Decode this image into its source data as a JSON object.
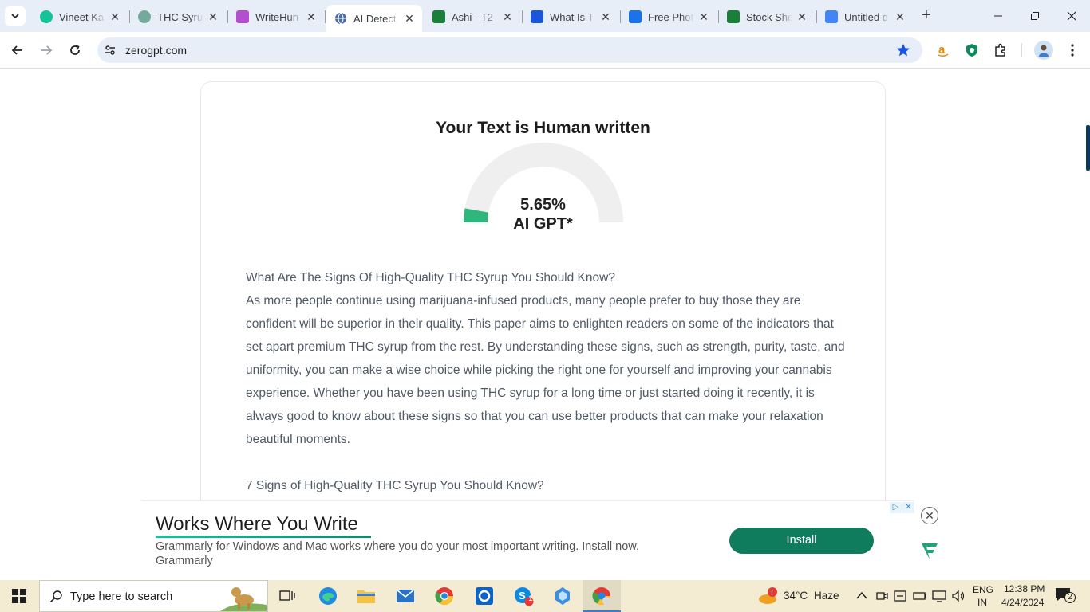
{
  "browser": {
    "tabs": [
      {
        "title": "Vineet Ka",
        "icon": "grammarly-icon",
        "color": "#15c39a",
        "active": false
      },
      {
        "title": "THC Syru",
        "icon": "chatgpt-icon",
        "color": "#74aa9c",
        "active": false
      },
      {
        "title": "WriteHun",
        "icon": "writehuman-icon",
        "color": "#b44dd0",
        "active": false
      },
      {
        "title": "AI Detect",
        "icon": "globe-icon",
        "color": "#5f6368",
        "active": true
      },
      {
        "title": "Ashi - T2",
        "icon": "sheets-icon",
        "color": "#188038",
        "active": false
      },
      {
        "title": "What Is T",
        "icon": "bi-icon",
        "color": "#1a56db",
        "active": false
      },
      {
        "title": "Free Phot",
        "icon": "forms-icon",
        "color": "#1a73e8",
        "active": false
      },
      {
        "title": "Stock She",
        "icon": "sheets-icon",
        "color": "#188038",
        "active": false
      },
      {
        "title": "Untitled d",
        "icon": "docs-icon",
        "color": "#4285f4",
        "active": false
      }
    ],
    "url": "zerogpt.com"
  },
  "result": {
    "title": "Your Text is Human written",
    "percent_label": "5.65%",
    "percent_value": 5.65,
    "gauge_label": "AI GPT*",
    "accent_color": "#2fb67c"
  },
  "content": {
    "heading": "What Are The Signs Of High-Quality THC Syrup You Should Know?",
    "paragraph": "As more people continue using marijuana-infused products, many people prefer to buy those they are confident will be superior in their quality. This paper aims to enlighten readers on some of the indicators that set apart premium THC syrup from the rest. By understanding these signs, such as strength, purity, taste, and uniformity, you can make a wise choice while picking the right one for yourself and improving your cannabis experience. Whether you have been using THC syrup for a long time or just started doing it recently, it is always good to know about these signs so that you can use better products that can make your relaxation beautiful moments.",
    "subheading": "7 Signs of High-Quality THC Syrup You Should Know?"
  },
  "ad": {
    "title": "Works Where You Write",
    "description": "Grammarly for Windows and Mac works where you do your most important writing. Install now.",
    "brand": "Grammarly",
    "button_label": "Install",
    "button_color": "#0e7c5d"
  },
  "taskbar": {
    "search_placeholder": "Type here to search",
    "weather_temp": "34°C",
    "weather_desc": "Haze",
    "language": "ENG",
    "region": "IN",
    "time": "12:38 PM",
    "date": "4/24/2024",
    "notification_count": "2",
    "skype_badge": "1"
  }
}
